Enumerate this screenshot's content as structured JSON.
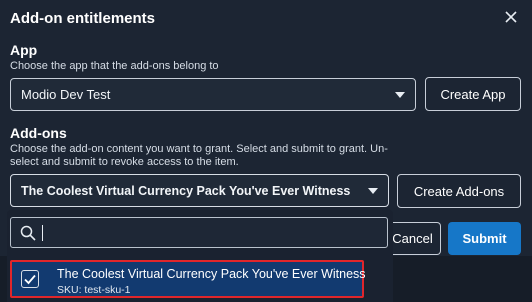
{
  "dialog": {
    "title": "Add-on entitlements"
  },
  "app_section": {
    "label": "App",
    "description": "Choose the app that the add-ons belong to",
    "selected_app": "Modio Dev Test",
    "create_button": "Create App"
  },
  "addons_section": {
    "label": "Add-ons",
    "description_line1": "Choose the add-on content you want to grant. Select and submit to grant. Un-",
    "description_line2": "select and submit to revoke access to the item.",
    "selected_addon": "The Coolest Virtual Currency Pack You've Ever Witness",
    "create_button": "Create Add-ons"
  },
  "dropdown": {
    "search_value": "",
    "options": [
      {
        "title": "The Coolest Virtual Currency Pack You've Ever Witness",
        "sku": "SKU: test-sku-1",
        "checked": true
      }
    ]
  },
  "actions": {
    "cancel": "Cancel",
    "submit": "Submit"
  },
  "colors": {
    "background": "#1c2533",
    "primary": "#1677c8",
    "highlight_border": "#e0262b",
    "selected_option_bg": "#123a70"
  }
}
